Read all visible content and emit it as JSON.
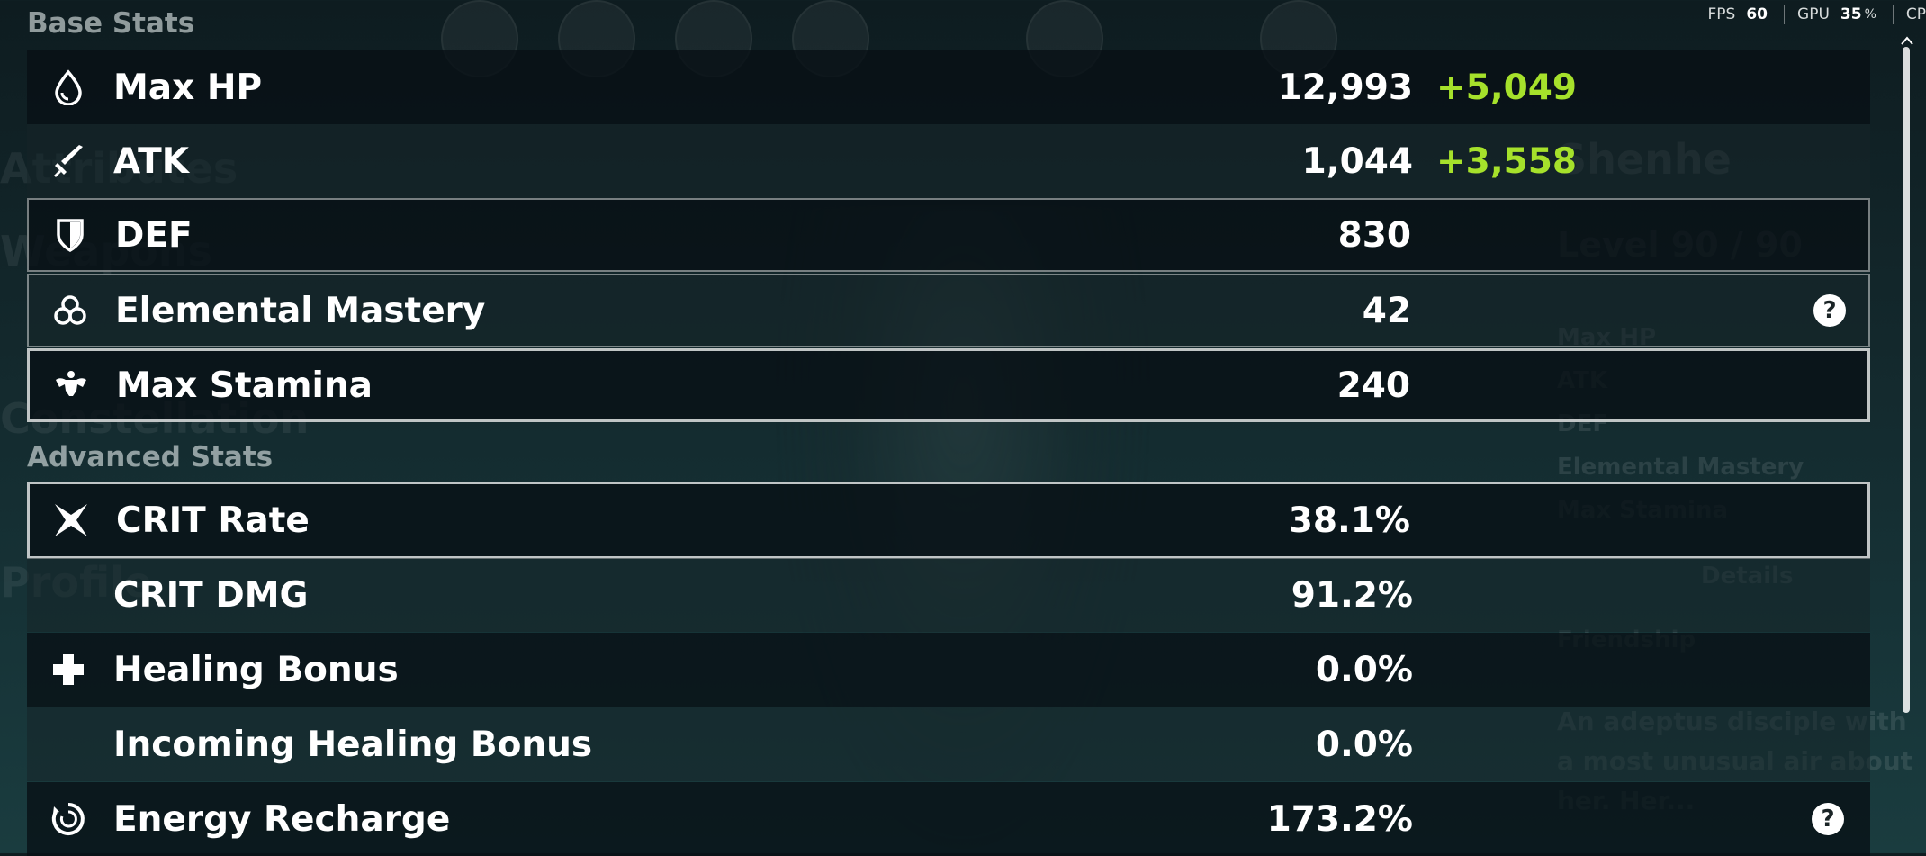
{
  "hud": {
    "fps_label": "FPS",
    "fps_value": "60",
    "gpu_label": "GPU",
    "gpu_value": "35",
    "gpu_unit": "%",
    "cpu_label_partial": "CP"
  },
  "background_ghost_text": {
    "side_1": "Attributes",
    "side_2": "Weapons",
    "side_3": "Constellation",
    "side_4": "Profile",
    "character_name": "Shenhe",
    "character_level": "Level 90 / 90",
    "panel_items": [
      "Max HP",
      "ATK",
      "DEF",
      "Elemental Mastery",
      "Max Stamina"
    ],
    "details": "Details",
    "friendship": "Friendship",
    "description": "An adeptus disciple with a most unusual air about her. Her..."
  },
  "base_stats": {
    "title": "Base Stats",
    "rows": [
      {
        "label": "Max HP",
        "value": "12,993",
        "bonus": "+5,049",
        "icon": "hp-drop-icon"
      },
      {
        "label": "ATK",
        "value": "1,044",
        "bonus": "+3,558",
        "icon": "sword-icon"
      },
      {
        "label": "DEF",
        "value": "830",
        "icon": "shield-icon"
      },
      {
        "label": "Elemental Mastery",
        "value": "42",
        "icon": "elemental-mastery-icon",
        "help": "?"
      },
      {
        "label": "Max Stamina",
        "value": "240",
        "icon": "stamina-icon"
      }
    ]
  },
  "advanced_stats": {
    "title": "Advanced Stats",
    "rows": [
      {
        "label": "CRIT Rate",
        "value": "38.1%",
        "icon": "crit-star-icon"
      },
      {
        "label": "CRIT DMG",
        "value": "91.2%"
      },
      {
        "label": "Healing Bonus",
        "value": "0.0%",
        "icon": "healing-cross-icon"
      },
      {
        "label": "Incoming Healing Bonus",
        "value": "0.0%"
      },
      {
        "label": "Energy Recharge",
        "value": "173.2%",
        "icon": "energy-recharge-icon",
        "help": "?"
      }
    ]
  },
  "colors": {
    "bonus_green": "#a6e12b",
    "text_white": "#ffffff",
    "section_title": "#e1e8e8"
  }
}
